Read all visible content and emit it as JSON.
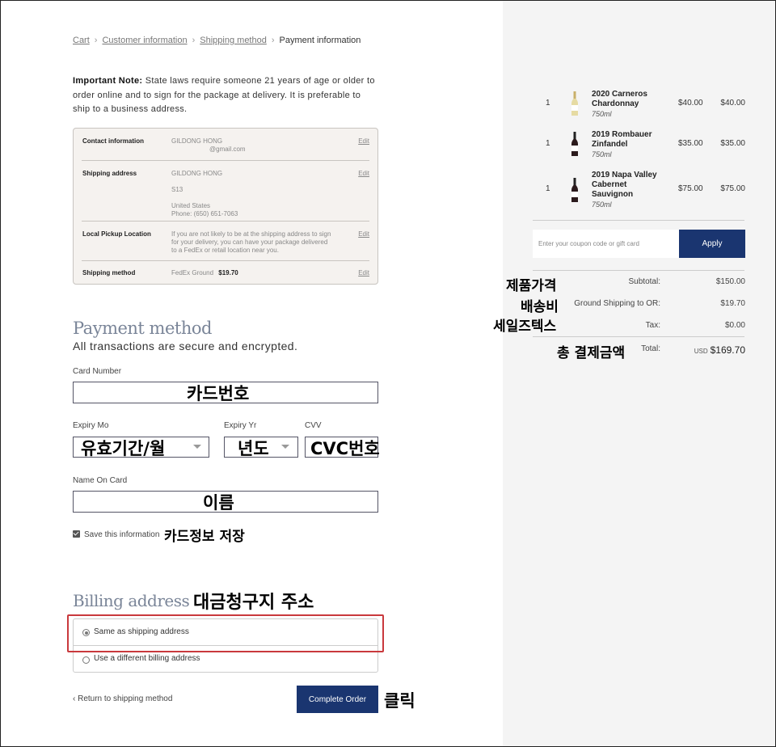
{
  "breadcrumb": {
    "cart": "Cart",
    "customer": "Customer information",
    "shipping": "Shipping method",
    "current": "Payment information",
    "sep": "›"
  },
  "note": {
    "bold": "Important Note:",
    "text": " State laws require someone 21 years of age or older to order online and to sign for the package at delivery. It is preferable to ship to a business address."
  },
  "review": {
    "contact_label": "Contact information",
    "contact_name": "GILDONG HONG",
    "contact_email": "@gmail.com",
    "shipping_label": "Shipping address",
    "shipping_name": "GILDONG HONG",
    "shipping_line2": "S13",
    "shipping_country": "United States",
    "shipping_phone": "Phone: (650) 651-7063",
    "pickup_label": "Local Pickup Location",
    "pickup_text": "If you are not likely to be at the shipping address to sign for your delivery, you can have your package delivered to a FedEx or retail location near you.",
    "method_label": "Shipping method",
    "method_name": "FedEx Ground",
    "method_price": "$19.70",
    "edit": "Edit"
  },
  "payment": {
    "title": "Payment method",
    "subtitle": "All transactions are secure and encrypted.",
    "card_number_label": "Card Number",
    "expiry_mo_label": "Expiry Mo",
    "expiry_yr_label": "Expiry Yr",
    "cvv_label": "CVV",
    "name_label": "Name On Card",
    "save_label": "Save this information"
  },
  "annotations": {
    "card_number": "카드번호",
    "expiry_mo": "유효기간/월",
    "expiry_yr": "년도",
    "cvc": "CVC번호",
    "name": "이름",
    "save": "카드정보 저장",
    "billing": "대금청구지 주소",
    "click": "클릭",
    "subtotal": "제품가격",
    "shipping": "배송비",
    "tax": "세일즈텍스",
    "total": "총 결제금액"
  },
  "billing": {
    "title": "Billing address",
    "same": "Same as shipping address",
    "different": "Use a different billing address"
  },
  "actions": {
    "return": "‹  Return to shipping method",
    "complete": "Complete Order"
  },
  "cart": {
    "items": [
      {
        "qty": "1",
        "name": "2020 Carneros Chardonnay",
        "vol": "750ml",
        "price": "$40.00",
        "total": "$40.00"
      },
      {
        "qty": "1",
        "name": "2019 Rombauer Zinfandel",
        "vol": "750ml",
        "price": "$35.00",
        "total": "$35.00"
      },
      {
        "qty": "1",
        "name": "2019 Napa Valley Cabernet Sauvignon",
        "vol": "750ml",
        "price": "$75.00",
        "total": "$75.00"
      }
    ],
    "coupon_placeholder": "Enter your coupon code or gift card",
    "apply": "Apply",
    "subtotal_label": "Subtotal:",
    "subtotal": "$150.00",
    "shipping_label": "Ground Shipping to OR:",
    "shipping": "$19.70",
    "tax_label": "Tax:",
    "tax": "$0.00",
    "total_label": "Total:",
    "currency": "USD",
    "total": "$169.70"
  }
}
